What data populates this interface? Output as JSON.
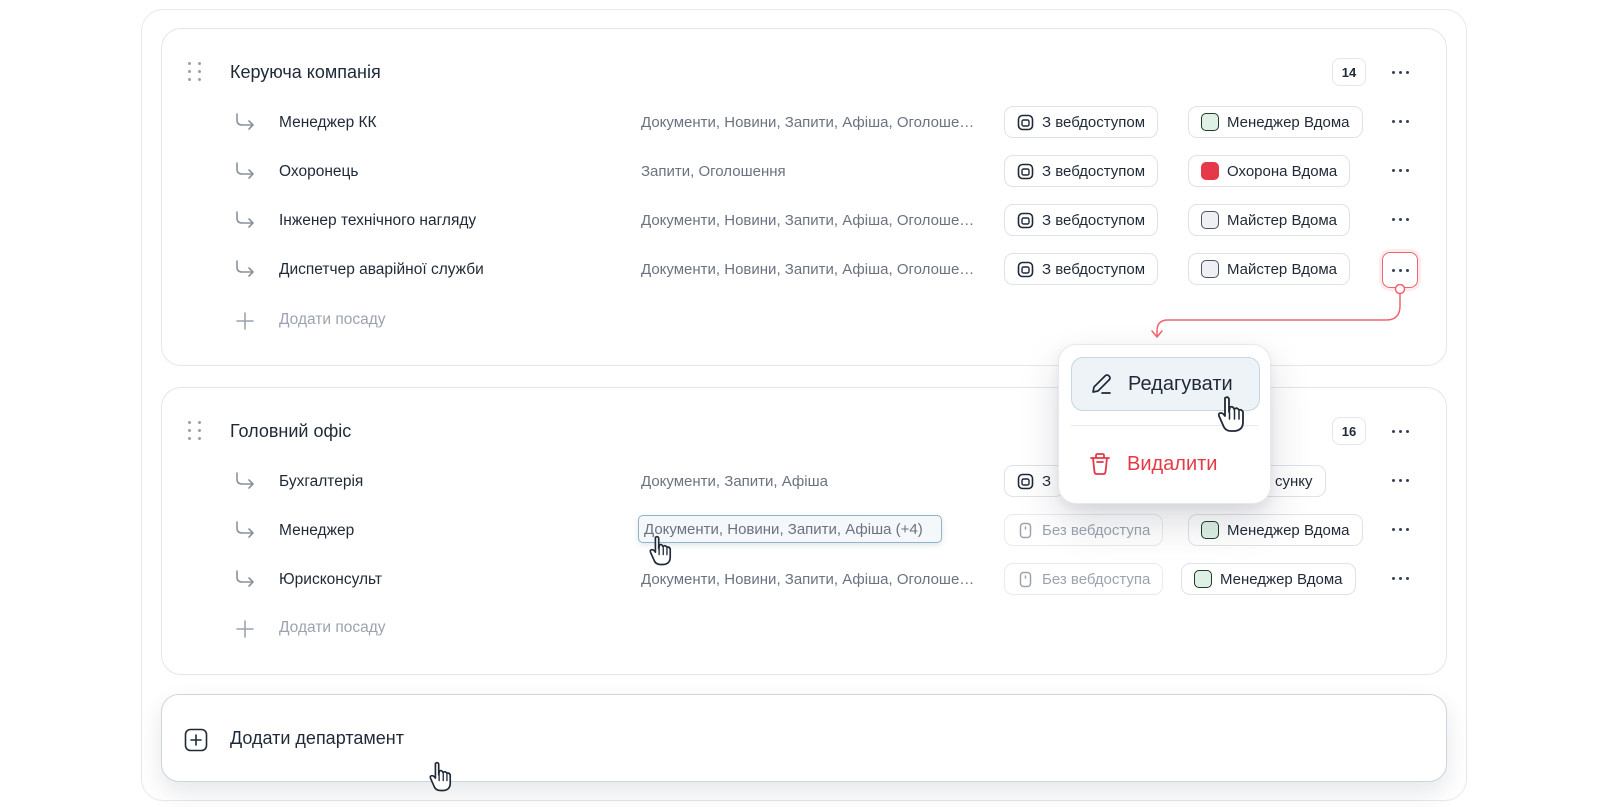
{
  "departments": [
    {
      "title": "Керуюча компанія",
      "count": "14",
      "positions": [
        {
          "name": "Менеджер КК",
          "permissions": "Документи, Новини, Запити, Афіша, Оголошення",
          "access": "З вебдоступом",
          "access_icon": "web-access-icon",
          "app": "Менеджер Вдома",
          "app_color": "#dff1e5"
        },
        {
          "name": "Охоронець",
          "permissions": "Запити, Оголошення",
          "access": "З вебдоступом",
          "access_icon": "web-access-icon",
          "app": "Охорона Вдома",
          "app_color": "#e5394a"
        },
        {
          "name": "Інженер технічного нагляду",
          "permissions": "Документи, Новини, Запити, Афіша, Оголошення",
          "access": "З вебдоступом",
          "access_icon": "web-access-icon",
          "app": "Майстер Вдома",
          "app_color": "#eef0f3"
        },
        {
          "name": "Диспетчер аварійної служби",
          "permissions": "Документи, Новини, Запити, Афіша, Оголошення",
          "access": "З вебдоступом",
          "access_icon": "web-access-icon",
          "app": "Майстер Вдома",
          "app_color": "#eef0f3"
        }
      ],
      "add_position": "Додати посаду"
    },
    {
      "title": "Головний офіс",
      "count": "16",
      "positions": [
        {
          "name": "Бухгалтерія",
          "permissions": "Документи, Запити, Афіша",
          "access": "З",
          "access_icon": "web-access-icon",
          "app": "сунку",
          "app_color": "#eef0f3"
        },
        {
          "name": "Менеджер",
          "permissions": "Документи, Новини, Запити, Афіша (+4)",
          "access": "Без вебдоступа",
          "access_icon": "no-web-access-icon",
          "app": "Менеджер Вдома",
          "app_color": "#dff1e5"
        },
        {
          "name": "Юрисконсульт",
          "permissions": "Документи, Новини, Запити, Афіша, Оголошення",
          "access": "Без вебдоступа",
          "access_icon": "no-web-access-icon",
          "app": "Менеджер Вдома",
          "app_color": "#dff1e5"
        }
      ],
      "add_position": "Додати посаду"
    }
  ],
  "context_menu": {
    "edit_label": "Редагувати",
    "delete_label": "Видалити"
  },
  "add_department_label": "Додати департамент",
  "colors": {
    "accent_red": "#e53945",
    "manager_app_green": "#dff1e5",
    "security_app_red": "#e5394a",
    "hover_border": "#93b4c6"
  }
}
